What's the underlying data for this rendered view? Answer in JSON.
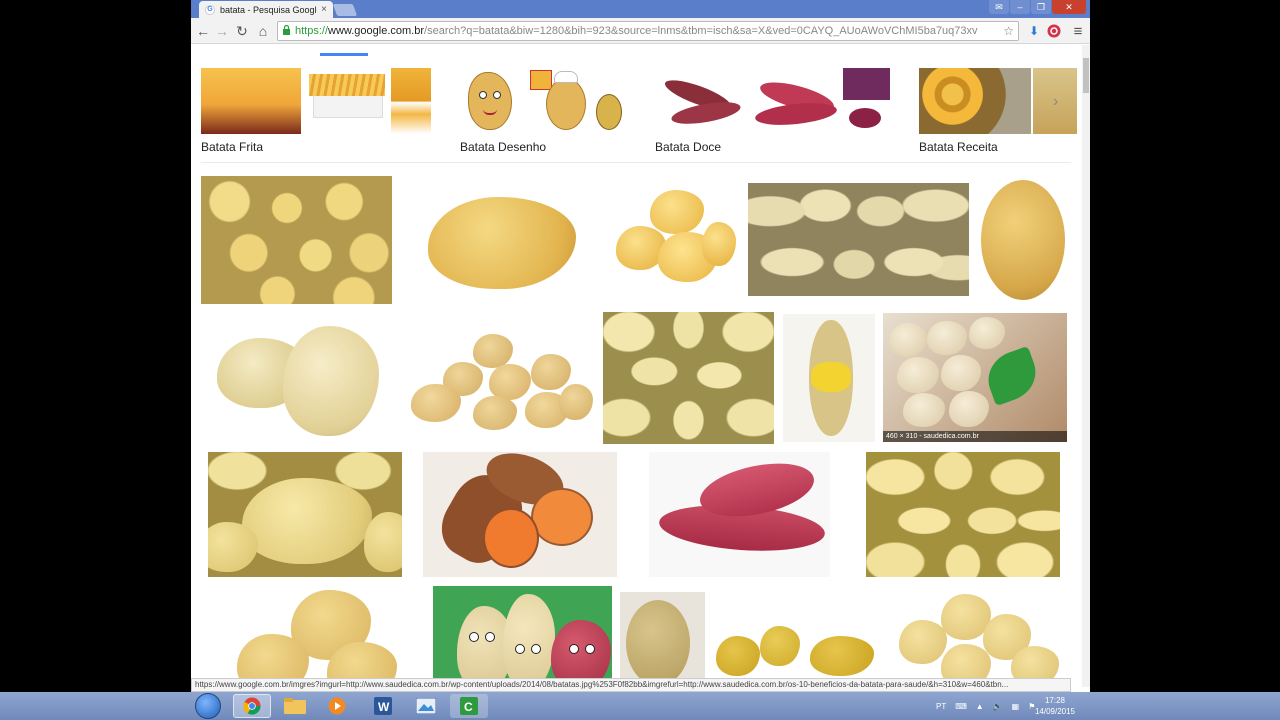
{
  "browser": {
    "tab_title": "batata - Pesquisa Google",
    "tab_close": "×",
    "favicon": "G",
    "url_scheme": "https://",
    "url_host": "www.google.com.br",
    "url_rest": "/search?q=batata&biw=1280&bih=923&source=lnms&tbm=isch&sa=X&ved=0CAYQ_AUoAWoVChMI5ba7uq73xv",
    "icons": {
      "back": "←",
      "forward": "→",
      "reload": "↻",
      "home": "⌂",
      "star": "☆",
      "download": "⬇",
      "menu": "≡",
      "lock": "🔒"
    },
    "window_buttons": [
      "✉",
      "–",
      "❐",
      "✕"
    ],
    "status_url": "https://www.google.com.br/imgres?imgurl=http://www.saudedica.com.br/wp-content/uploads/2014/08/batatas.jpg%253F0f82bb&imgrefurl=http://www.saudedica.com.br/os-10-beneficios-da-batata-para-saude/&h=310&w=460&tbn..."
  },
  "related_searches": [
    {
      "label": "Batata Frita"
    },
    {
      "label": "Batata Desenho"
    },
    {
      "label": "Batata Doce"
    },
    {
      "label": "Batata Receita"
    }
  ],
  "results": [
    {
      "caption": ""
    },
    {
      "caption": "460 × 310 - saudedica.com.br"
    }
  ],
  "taskbar": {
    "lang": "PT",
    "time": "17:28",
    "date": "14/09/2015"
  },
  "colors": {
    "potato_yellow": "#e8c66a",
    "potato_light": "#efdfa8",
    "sweet_red": "#b8354f",
    "sweet_brown": "#9a5a32",
    "sweet_orange": "#f28a3c",
    "fries": "#f1b43b"
  }
}
